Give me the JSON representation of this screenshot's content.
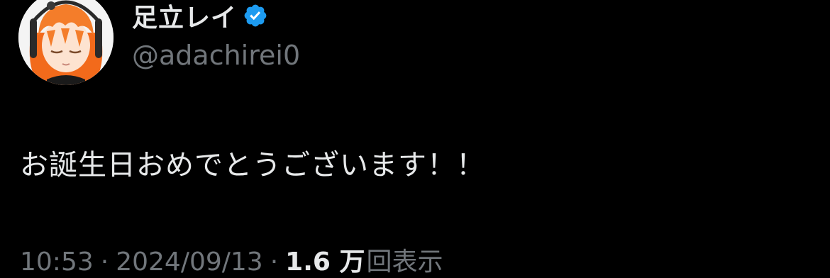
{
  "tweet": {
    "author": {
      "display_name": "足立レイ",
      "handle": "@adachirei0",
      "verified": true,
      "verified_color": "#1d9bf0"
    },
    "text": "お誕生日おめでとうございます！！",
    "meta": {
      "time": "10:53",
      "separator": "·",
      "date": "2024/09/13",
      "views_count": "1.6 万",
      "views_label": "回表示"
    }
  },
  "colors": {
    "background": "#000000",
    "primary_text": "#e7e9ea",
    "secondary_text": "#71767b",
    "accent": "#1d9bf0"
  }
}
